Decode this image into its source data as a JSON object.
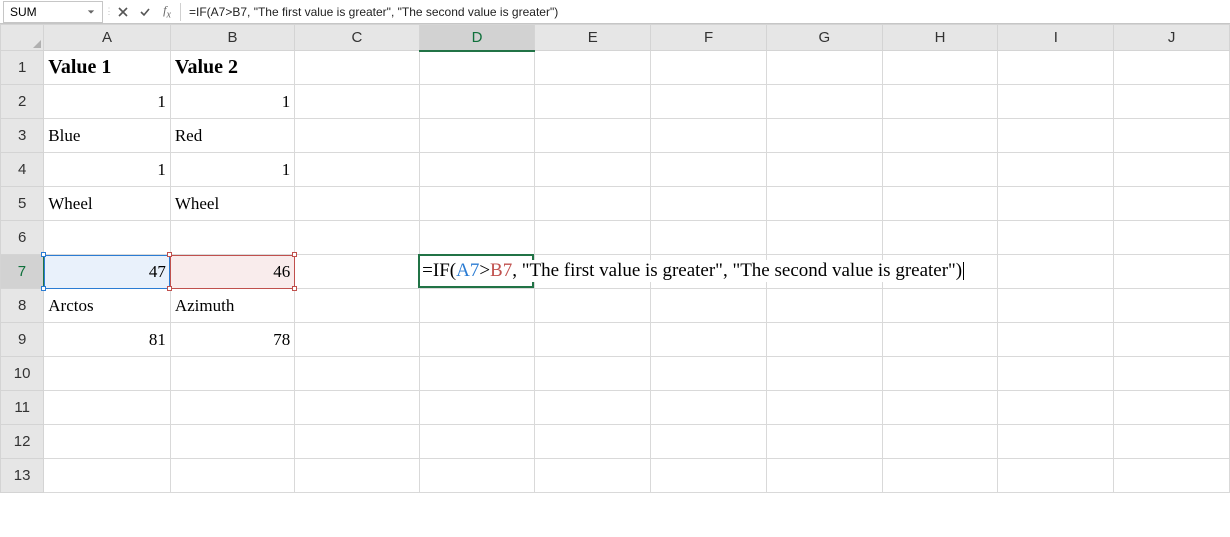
{
  "namebox": {
    "value": "SUM"
  },
  "formula_bar": {
    "text": "=IF(A7>B7, \"The first value is greater\", \"The second value is greater\")"
  },
  "columns": [
    "A",
    "B",
    "C",
    "D",
    "E",
    "F",
    "G",
    "H",
    "I",
    "J"
  ],
  "rows": [
    "1",
    "2",
    "3",
    "4",
    "5",
    "6",
    "7",
    "8",
    "9",
    "10",
    "11",
    "12",
    "13"
  ],
  "active_column": "D",
  "active_row": "7",
  "cells": {
    "A1": "Value 1",
    "B1": "Value 2",
    "A2": "1",
    "B2": "1",
    "A3": "Blue",
    "B3": "Red",
    "A4": "1",
    "B4": "1",
    "A5": "Wheel",
    "B5": "Wheel",
    "A7": "47",
    "B7": "46",
    "A8": "Arctos",
    "B8": "Azimuth",
    "A9": "81",
    "B9": "78"
  },
  "cell_formula": {
    "prefix": "=IF(",
    "ref1": "A7",
    "gt": ">",
    "ref2": "B7",
    "suffix": ", \"The first value is greater\", \"The second value is greater\")"
  },
  "icons": {
    "dropdown": "chevron-down-icon",
    "cancel": "x-icon",
    "enter": "check-icon",
    "fx": "fx-icon"
  }
}
